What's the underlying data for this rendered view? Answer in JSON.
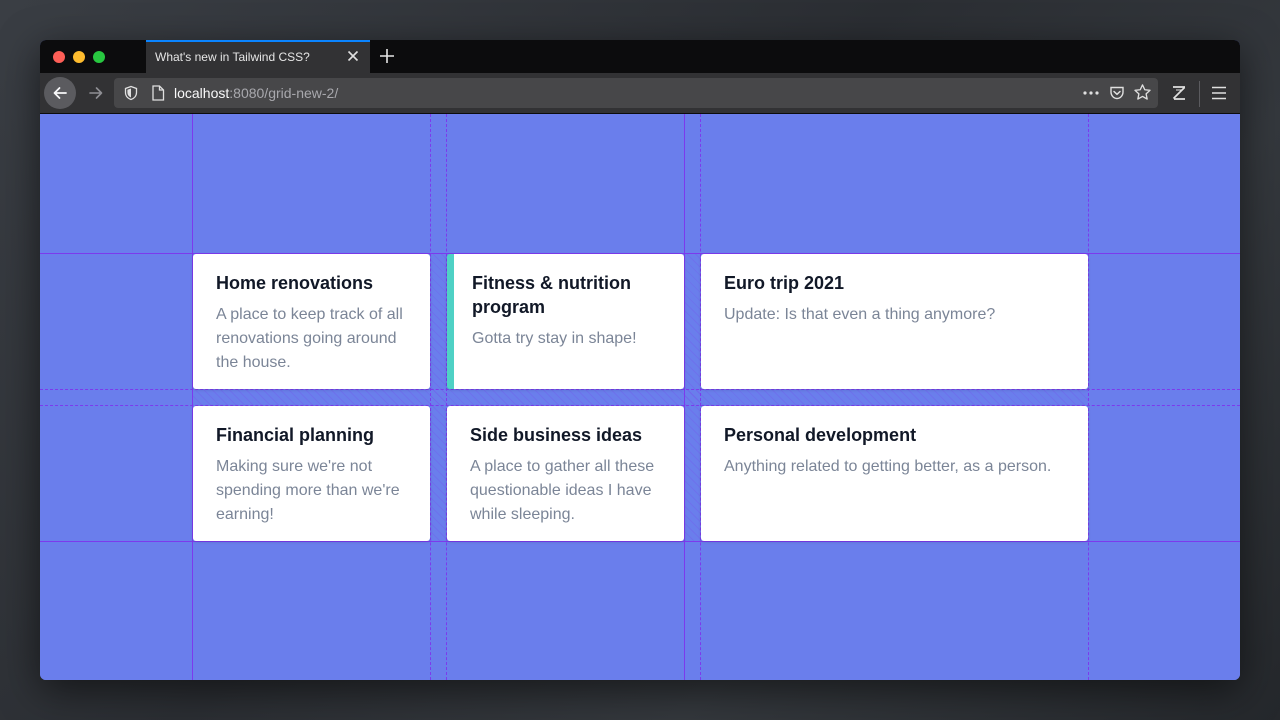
{
  "browser": {
    "tab": {
      "title": "What's new in Tailwind CSS?"
    },
    "url": {
      "host": "localhost",
      "rest": ":8080/grid-new-2/"
    },
    "colors": {
      "tab_accent": "#0a84ff",
      "page_bg": "#6a7eec",
      "grid_line": "#7c3aed",
      "card_accent": "#4fd1c5"
    },
    "icons": [
      "back-arrow-icon",
      "forward-arrow-icon",
      "shield-icon",
      "page-icon",
      "more-dots-icon",
      "pocket-icon",
      "star-icon",
      "zotero-icon",
      "hamburger-menu-icon",
      "close-icon",
      "plus-icon"
    ]
  },
  "cards": [
    {
      "title": "Home renovations",
      "description": "A place to keep track of all renovations going around the house."
    },
    {
      "title": "Fitness & nutrition program",
      "description": "Gotta try stay in shape!"
    },
    {
      "title": "Euro trip 2021",
      "description": "Update: Is that even a thing anymore?"
    },
    {
      "title": "Financial planning",
      "description": "Making sure we're not spending more than we're earning!"
    },
    {
      "title": "Side business ideas",
      "description": "A place to gather all these questionable ideas I have while sleeping."
    },
    {
      "title": "Personal development",
      "description": "Anything related to getting better, as a person."
    }
  ]
}
